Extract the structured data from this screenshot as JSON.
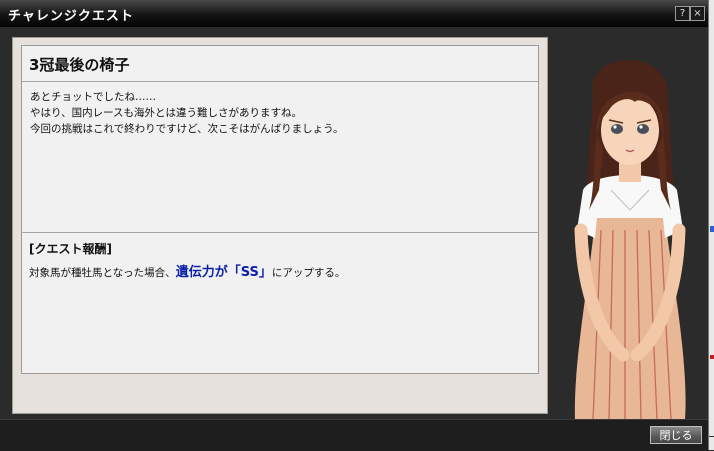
{
  "window": {
    "title": "チャレンジクエスト",
    "help_glyph": "?",
    "close_glyph": "×"
  },
  "quest": {
    "title": "3冠最後の椅子",
    "lines": [
      "あとチョットでしたね……",
      "やはり、国内レースも海外とは違う難しさがありますね。",
      "今回の挑戦はこれで終わりですけど、次こそはがんばりましょう。"
    ]
  },
  "reward": {
    "title": "[クエスト報酬]",
    "prefix": "対象馬が種牡馬となった場合、",
    "highlight": "遺伝力が「SS」",
    "suffix": "にアップする。"
  },
  "footer": {
    "close_label": "閉じる"
  },
  "colors": {
    "highlight": "#0b1fa8",
    "panel": "#e6e1dc",
    "inner": "#f1f1f1"
  },
  "icons": {
    "help": "help-icon",
    "close": "close-icon"
  }
}
